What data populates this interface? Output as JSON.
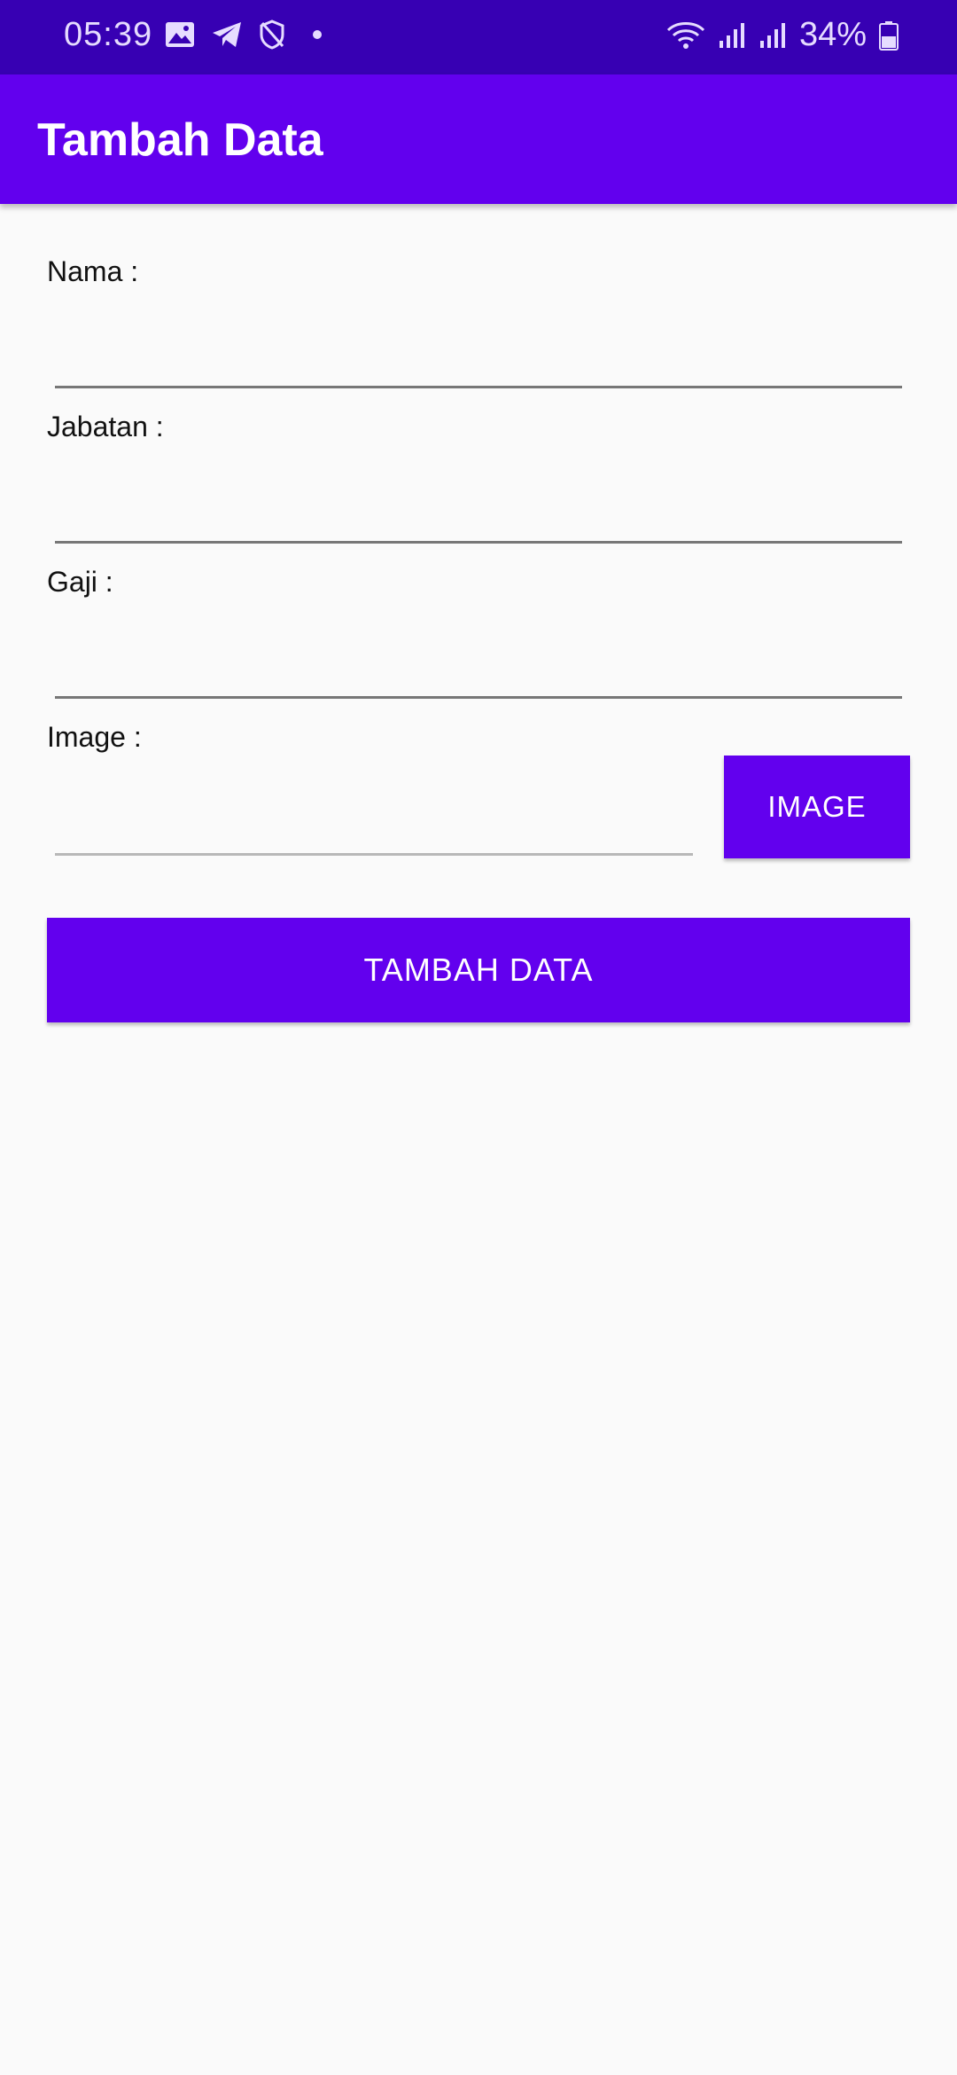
{
  "status_bar": {
    "time": "05:39",
    "battery": "34%",
    "icons_left": [
      "gallery-icon",
      "telegram-icon",
      "shield-icon",
      "dot-icon"
    ],
    "icons_right": [
      "wifi-icon",
      "signal-icon",
      "signal-icon",
      "battery-icon"
    ]
  },
  "app_bar": {
    "title": "Tambah Data"
  },
  "form": {
    "nama_label": "Nama :",
    "nama_value": "",
    "jabatan_label": "Jabatan :",
    "jabatan_value": "",
    "gaji_label": "Gaji :",
    "gaji_value": "",
    "image_label": "Image :",
    "image_value": "",
    "image_button": "IMAGE",
    "submit_button": "TAMBAH DATA"
  },
  "colors": {
    "primary": "#6200ee",
    "primary_dark": "#3700b3",
    "background": "#fafafa"
  }
}
